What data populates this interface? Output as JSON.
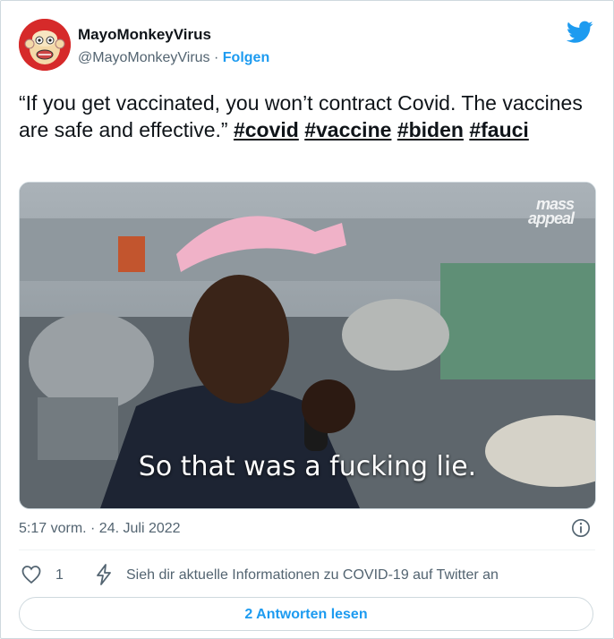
{
  "author": {
    "name": "MayoMonkeyVirus",
    "handle": "@MayoMonkeyVirus",
    "separator": " · ",
    "follow_label": "Folgen",
    "avatar_icon": "monkey-avatar-icon"
  },
  "tweet": {
    "text_plain": "“If you get vaccinated, you won’t contract Covid. The vaccines are safe and effective.” ",
    "hashtags": [
      "#covid",
      "#vaccine",
      "#biden",
      "#fauci"
    ]
  },
  "media": {
    "caption": "So that was a fucking lie.",
    "watermark_line1": "mass",
    "watermark_line2": "appeal"
  },
  "meta": {
    "timestamp": "5:17 vorm. · 24. Juli 2022"
  },
  "actions": {
    "like_count": "1",
    "info_text": "Sieh dir aktuelle Informationen zu COVID-19 auf Twitter an"
  },
  "replies_button": {
    "label": "2 Antworten lesen"
  },
  "colors": {
    "accent": "#1d9bf0",
    "text": "#0f1419",
    "muted": "#536471",
    "border": "#cfd9de"
  }
}
